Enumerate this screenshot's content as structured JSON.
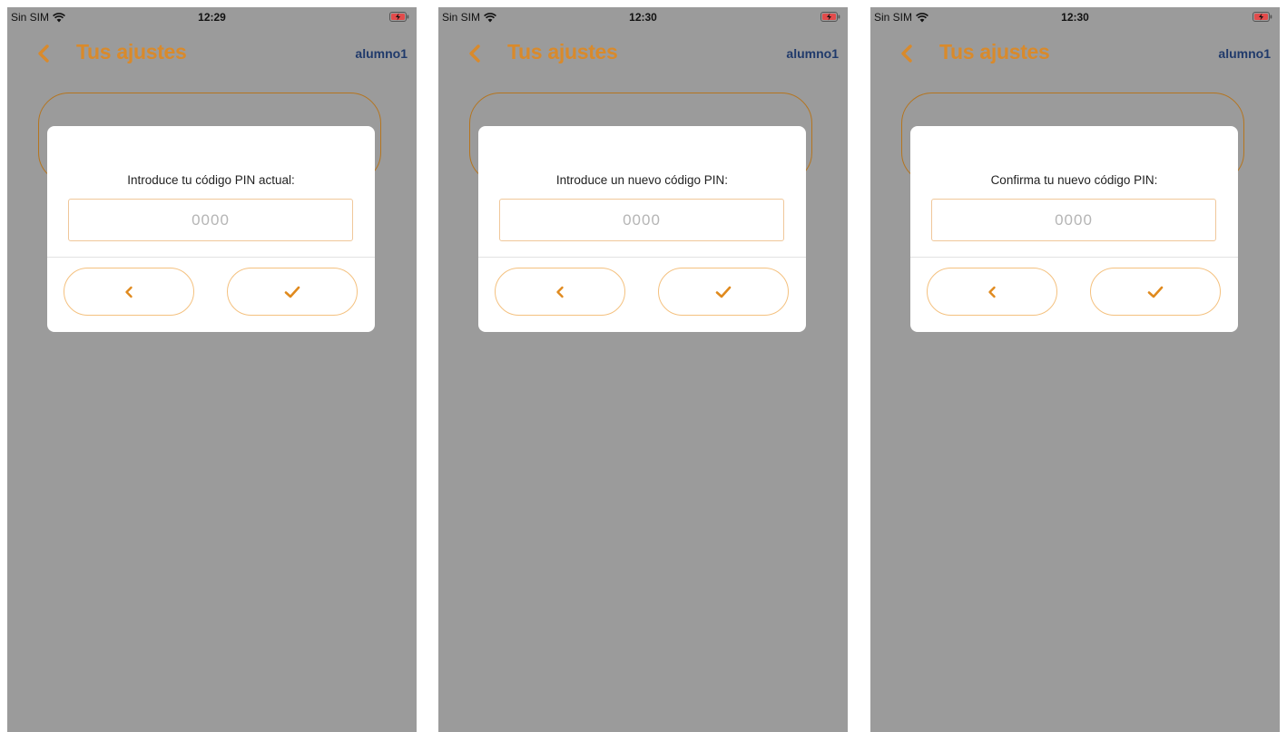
{
  "accent_color": "#d98a2b",
  "user_color": "#203a6b",
  "screens": [
    {
      "status": {
        "carrier": "Sin SIM",
        "time": "12:29"
      },
      "nav": {
        "title": "Tus ajustes",
        "user": "alumno1"
      },
      "dialog": {
        "prompt": "Introduce tu código PIN actual:",
        "input_placeholder": "0000",
        "back_icon": "chevron-left-icon",
        "confirm_icon": "checkmark-icon"
      }
    },
    {
      "status": {
        "carrier": "Sin SIM",
        "time": "12:30"
      },
      "nav": {
        "title": "Tus ajustes",
        "user": "alumno1"
      },
      "dialog": {
        "prompt": "Introduce un nuevo código PIN:",
        "input_placeholder": "0000",
        "back_icon": "chevron-left-icon",
        "confirm_icon": "checkmark-icon"
      }
    },
    {
      "status": {
        "carrier": "Sin SIM",
        "time": "12:30"
      },
      "nav": {
        "title": "Tus ajustes",
        "user": "alumno1"
      },
      "dialog": {
        "prompt": "Confirma tu nuevo código PIN:",
        "input_placeholder": "0000",
        "back_icon": "chevron-left-icon",
        "confirm_icon": "checkmark-icon"
      }
    }
  ]
}
